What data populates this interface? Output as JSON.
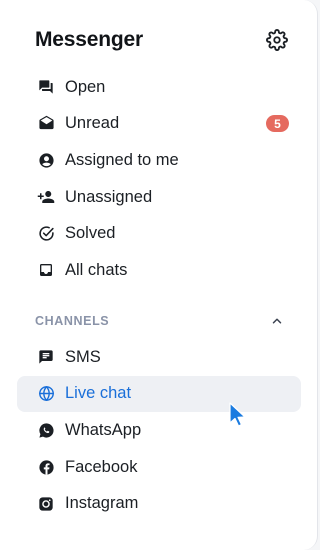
{
  "header": {
    "title": "Messenger",
    "settings_icon": "gear-icon"
  },
  "inbox_items": [
    {
      "label": "Open",
      "icon": "chat-bubbles-icon"
    },
    {
      "label": "Unread",
      "icon": "envelope-open-icon",
      "badge": "5"
    },
    {
      "label": "Assigned to me",
      "icon": "user-circle-icon"
    },
    {
      "label": "Unassigned",
      "icon": "user-plus-icon"
    },
    {
      "label": "Solved",
      "icon": "check-circle-icon"
    },
    {
      "label": "All chats",
      "icon": "inbox-icon"
    }
  ],
  "channels": {
    "title": "CHANNELS",
    "toggle_icon": "chevron-up-icon",
    "items": [
      {
        "label": "SMS",
        "icon": "sms-icon"
      },
      {
        "label": "Live chat",
        "icon": "globe-icon",
        "active": true
      },
      {
        "label": "WhatsApp",
        "icon": "whatsapp-icon"
      },
      {
        "label": "Facebook",
        "icon": "facebook-icon"
      },
      {
        "label": "Instagram",
        "icon": "instagram-icon"
      }
    ]
  },
  "colors": {
    "accent": "#1a6fd9",
    "badge": "#e56a5f",
    "active_bg": "#eef0f4",
    "section_title": "#8a93a8"
  }
}
